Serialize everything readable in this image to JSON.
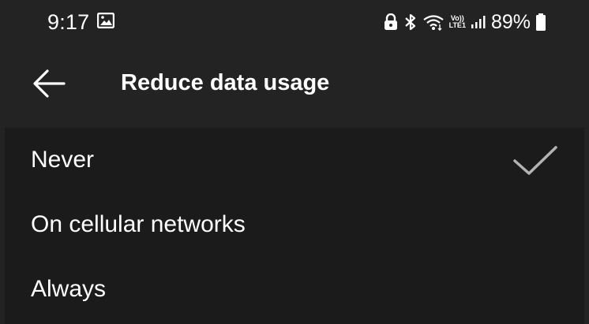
{
  "status_bar": {
    "time": "9:17",
    "battery_percent": "89%",
    "network_label_top": "Vo))",
    "network_label_bottom": "LTE1",
    "icons": [
      "gallery-icon",
      "lock-icon",
      "bluetooth-icon",
      "wifi-icon",
      "volte-icon",
      "signal-icon",
      "battery-icon"
    ]
  },
  "header": {
    "back_icon": "arrow-left-icon",
    "title": "Reduce data usage"
  },
  "options": {
    "items": [
      {
        "label": "Never",
        "selected": true
      },
      {
        "label": "On cellular networks",
        "selected": false
      },
      {
        "label": "Always",
        "selected": false
      }
    ],
    "check_icon": "checkmark-icon"
  },
  "colors": {
    "background": "#232323",
    "panel": "#1b1b1b",
    "text": "#ffffff",
    "checkmark": "#b3b3b3"
  }
}
